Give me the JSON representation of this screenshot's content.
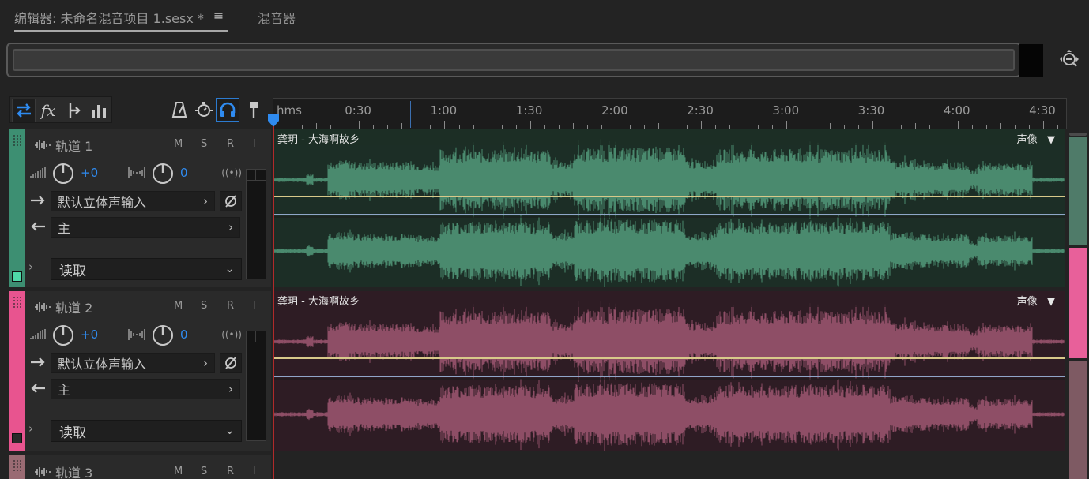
{
  "tabs": {
    "editor_label": "编辑器: 未命名混音项目 1.sesx *",
    "menu_icon": "hamburger-icon",
    "mixer_label": "混音器"
  },
  "toolbar": {
    "icons": [
      "swap-arrows-icon",
      "fx-icon",
      "send-icon",
      "eq-bars-icon",
      "metronome-icon",
      "timer-icon",
      "headphone-icon",
      "marker-pin-icon"
    ],
    "accent": "#2f8bf0"
  },
  "ruler": {
    "unit_label": "hms",
    "labels": [
      "0:30",
      "1:00",
      "1:30",
      "2:00",
      "2:30",
      "3:00",
      "3:30",
      "4:00",
      "4:30"
    ],
    "time_start_s": 0,
    "time_end_s": 278
  },
  "tracks": [
    {
      "name": "轨道 1",
      "color": "#3d8f72",
      "m": "M",
      "s": "S",
      "r": "R",
      "i": "I",
      "volume": "+0",
      "pan": "0",
      "input": "默认立体声输入",
      "output": "主",
      "automation": "读取",
      "clip": {
        "title": "龚玥 - 大海啊故乡",
        "pan_label": "声像",
        "bg": "#1c2e26",
        "wave": "#4a8a6e",
        "seed": 7
      }
    },
    {
      "name": "轨道 2",
      "color": "#e8548f",
      "m": "M",
      "s": "S",
      "r": "R",
      "i": "I",
      "volume": "+0",
      "pan": "0",
      "input": "默认立体声输入",
      "output": "主",
      "automation": "读取",
      "clip": {
        "title": "龚玥 - 大海啊故乡",
        "pan_label": "声像",
        "bg": "#2e1c24",
        "wave": "#8e4e66",
        "seed": 7
      }
    },
    {
      "name": "轨道 3",
      "m": "M",
      "s": "S",
      "r": "R",
      "i": "I"
    }
  ]
}
